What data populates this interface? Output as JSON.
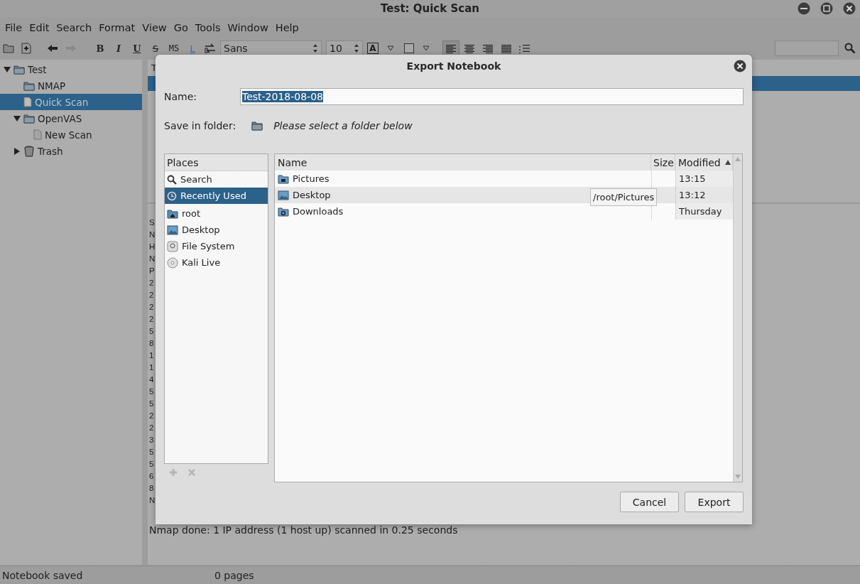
{
  "window": {
    "title": "Test: Quick Scan"
  },
  "menu": [
    "File",
    "Edit",
    "Search",
    "Format",
    "View",
    "Go",
    "Tools",
    "Window",
    "Help"
  ],
  "toolbar": {
    "format_buttons": [
      {
        "label": "B",
        "kind": "bold"
      },
      {
        "label": "I",
        "kind": "italic"
      },
      {
        "label": "U",
        "kind": "underline"
      },
      {
        "label": "S",
        "kind": "strike"
      },
      {
        "label": "MS",
        "kind": "mono"
      },
      {
        "label": "L",
        "kind": "link"
      }
    ],
    "font": "Sans",
    "size": "10",
    "text_color_button": "A",
    "align_buttons": [
      {
        "kind": "left",
        "selected": true
      },
      {
        "kind": "center",
        "selected": false
      },
      {
        "kind": "right",
        "selected": false
      },
      {
        "kind": "justify",
        "selected": false
      },
      {
        "kind": "bullets",
        "selected": false
      }
    ]
  },
  "tree": [
    {
      "label": "Test",
      "kind": "folder",
      "expanded": true,
      "selected": false,
      "children": [
        {
          "label": "NMAP",
          "kind": "folder",
          "selected": false
        },
        {
          "label": "Quick Scan",
          "kind": "page",
          "selected": true
        },
        {
          "label": "OpenVAS",
          "kind": "folder",
          "expanded": true,
          "selected": false,
          "children": [
            {
              "label": "New Scan",
              "kind": "page",
              "selected": false
            }
          ]
        },
        {
          "label": "Trash",
          "kind": "trash",
          "expanded": false,
          "selected": false
        }
      ]
    }
  ],
  "editor": {
    "list_header": "T",
    "line_starts": [
      "S",
      "N",
      "H",
      "N",
      "P",
      "2",
      "2",
      "2",
      "2",
      "5",
      "8",
      "1",
      "1",
      "4",
      "5",
      "5",
      "2",
      "2",
      "3",
      "5",
      "5",
      "6",
      "8",
      "N"
    ],
    "last_line": "Nmap done: 1 IP address (1 host up) scanned in 0.25 seconds"
  },
  "dialog": {
    "title": "Export Notebook",
    "name_label": "Name:",
    "name_value": "Test-2018-08-08",
    "value_selected": true,
    "folder_label": "Save in folder:",
    "folder_hint": "Please select a folder below",
    "places_header": "Places",
    "places": [
      {
        "label": "Search",
        "kind": "search",
        "selected": false
      },
      {
        "label": "Recently Used",
        "kind": "recent",
        "selected": true
      },
      {
        "label": "root",
        "kind": "home",
        "selected": false
      },
      {
        "label": "Desktop",
        "kind": "desktop",
        "selected": false
      },
      {
        "label": "File System",
        "kind": "disk",
        "selected": false
      },
      {
        "label": "Kali Live",
        "kind": "cd",
        "selected": false
      }
    ],
    "places_add_disabled": true,
    "columns": [
      "Name",
      "Size",
      "Modified"
    ],
    "files": [
      {
        "name": "Pictures",
        "kind": "pictures",
        "modified": "13:15",
        "highlighted": false
      },
      {
        "name": "Desktop",
        "kind": "desktop",
        "modified": "13:12",
        "highlighted": true
      },
      {
        "name": "Downloads",
        "kind": "downloads",
        "modified": "Thursday",
        "highlighted": false
      }
    ],
    "tooltip": "/root/Pictures",
    "buttons": [
      "Cancel",
      "Export"
    ]
  },
  "status_bar": {
    "message": "Notebook saved",
    "pages": "0 pages"
  }
}
